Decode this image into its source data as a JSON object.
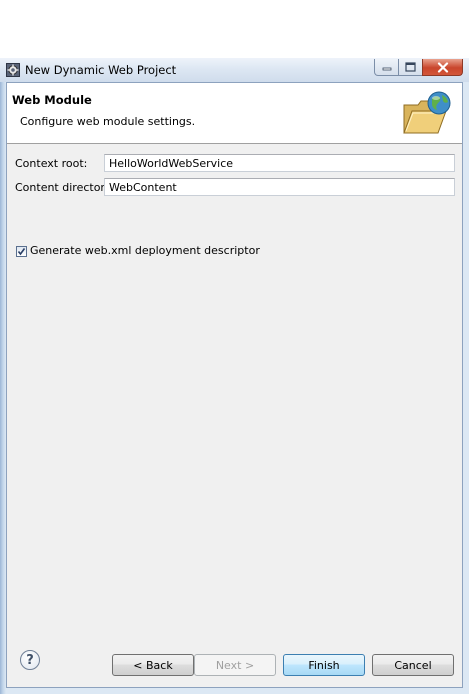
{
  "window": {
    "title": "New Dynamic Web Project"
  },
  "banner": {
    "title": "Web Module",
    "description": "Configure web module settings."
  },
  "form": {
    "context_root_label": "Context root:",
    "context_root_value": "HelloWorldWebService",
    "content_directory_label": "Content directory:",
    "content_directory_value": "WebContent",
    "generate_descriptor_label": "Generate web.xml deployment descriptor",
    "generate_descriptor_checked": true
  },
  "buttons": {
    "help_label": "?",
    "back_label": "< Back",
    "next_label": "Next >",
    "finish_label": "Finish",
    "cancel_label": "Cancel"
  },
  "colors": {
    "accent": "#3c7fb1",
    "close_button": "#c9462c"
  },
  "icons": {
    "window_icon": "eclipse-gear-icon",
    "banner_icon": "folder-globe-icon"
  }
}
